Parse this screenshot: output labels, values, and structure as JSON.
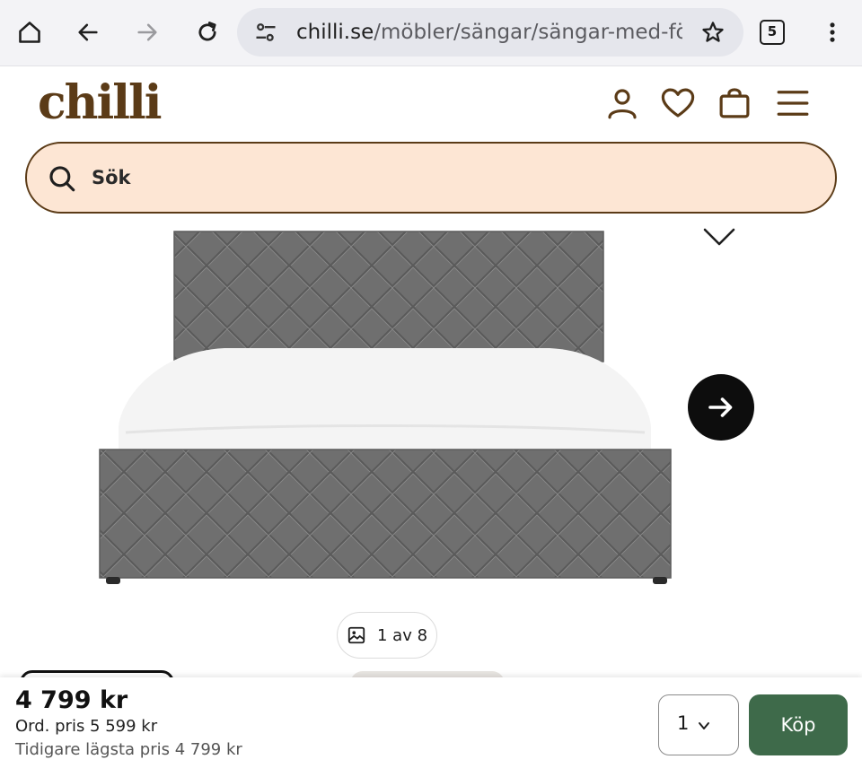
{
  "browser": {
    "url_host": "chilli.se",
    "url_path": "/möbler/sängar/sängar-med-förvar",
    "tab_count": "5"
  },
  "site": {
    "logo_text": "chilli",
    "brand_color": "#5b3b17",
    "search_placeholder": "Sök",
    "search_bg_color": "#fde6d4"
  },
  "header_icons": [
    "user-icon",
    "heart-icon",
    "shopping-bag-icon",
    "menu-icon"
  ],
  "gallery": {
    "image_index": "1 av 8",
    "icons": [
      "chevron-down-icon",
      "arrow-right-icon",
      "image-icon"
    ]
  },
  "purchase": {
    "price": "4 799 kr",
    "ordinary_price": "Ord. pris 5 599 kr",
    "lowest_price": "Tidigare lägsta pris 4 799 kr",
    "quantity": "1",
    "buy_label": "Köp",
    "buy_color": "#3e6a4a"
  }
}
